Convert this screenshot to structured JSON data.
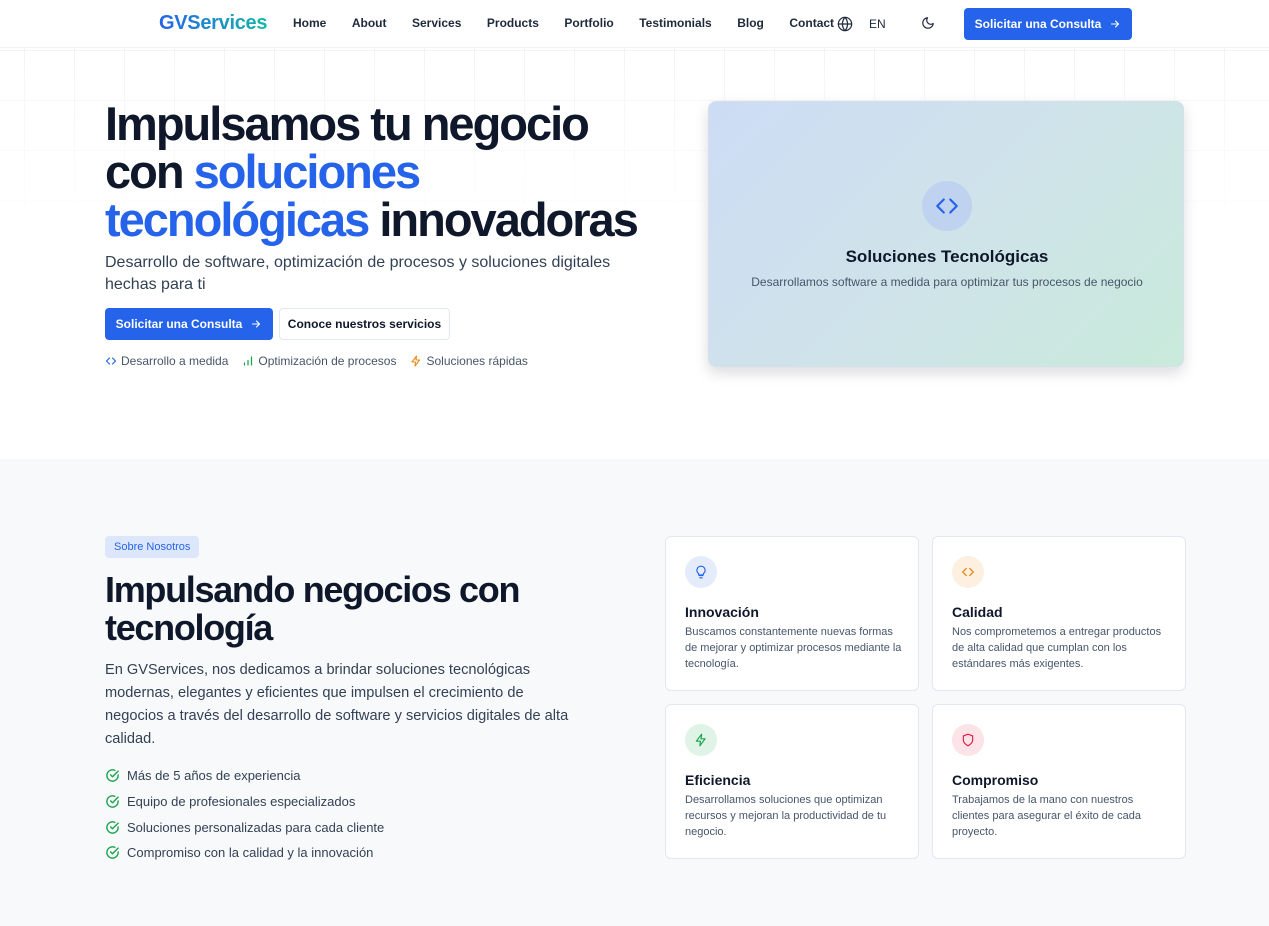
{
  "nav": {
    "logo": "GVServices",
    "links": [
      "Home",
      "About",
      "Services",
      "Products",
      "Portfolio",
      "Testimonials",
      "Blog",
      "Contact"
    ],
    "lang": "EN",
    "cta": "Solicitar una Consulta",
    "globe_icon": "globe-icon",
    "theme_icon": "moon-icon"
  },
  "hero": {
    "title_1": "Impulsamos tu negocio",
    "title_2": "con",
    "title_hl_1": "soluciones",
    "title_hl_2": "tecnológicas",
    "title_3": "innovadoras",
    "subtitle": "Desarrollo de software, optimización de procesos y soluciones digitales hechas para ti",
    "cta_primary": "Solicitar una Consulta",
    "cta_secondary": "Conoce nuestros servicios",
    "features": [
      "Desarrollo a medida",
      "Optimización de procesos",
      "Soluciones rápidas"
    ],
    "card": {
      "title": "Soluciones Tecnológicas",
      "desc": "Desarrollamos software a medida para optimizar tus procesos de negocio"
    }
  },
  "about": {
    "badge": "Sobre Nosotros",
    "title": "Impulsando negocios con tecnología",
    "desc": "En GVServices, nos dedicamos a brindar soluciones tecnológicas modernas, elegantes y eficientes que impulsen el crecimiento de negocios a través del desarrollo de software y servicios digitales de alta calidad.",
    "checks": [
      "Más de 5 años de experiencia",
      "Equipo de profesionales especializados",
      "Soluciones personalizadas para cada cliente",
      "Compromiso con la calidad y la innovación"
    ],
    "values": [
      {
        "title": "Innovación",
        "desc": "Buscamos constantemente nuevas formas de mejorar y optimizar procesos mediante la tecnología.",
        "icon": "lightbulb-icon"
      },
      {
        "title": "Calidad",
        "desc": "Nos comprometemos a entregar productos de alta calidad que cumplan con los estándares más exigentes.",
        "icon": "code-icon"
      },
      {
        "title": "Eficiencia",
        "desc": "Desarrollamos soluciones que optimizan recursos y mejoran la productividad de tu negocio.",
        "icon": "lightning-icon"
      },
      {
        "title": "Compromiso",
        "desc": "Trabajamos de la mano con nuestros clientes para asegurar el éxito de cada proyecto.",
        "icon": "shield-icon"
      }
    ]
  },
  "colors": {
    "primary": "#2563eb",
    "teal": "#14b8a6",
    "green": "#16a34a",
    "orange": "#ea8a1b",
    "red": "#e11d48"
  }
}
